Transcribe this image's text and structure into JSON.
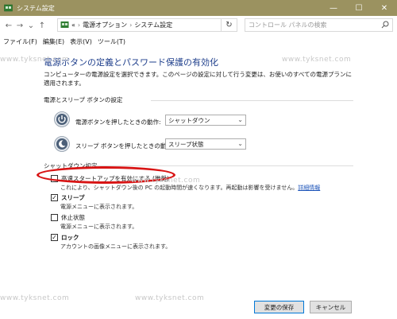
{
  "window": {
    "title": "システム設定",
    "minimize": "—",
    "maximize": "☐",
    "close": "✕"
  },
  "toolbar": {
    "back": "←",
    "forward": "→",
    "recent": "⌄",
    "up": "↑",
    "refresh": "↻"
  },
  "breadcrumb": {
    "overflow": "«",
    "items": [
      "電源オプション",
      "システム設定"
    ]
  },
  "search": {
    "placeholder": "コントロール パネルの検索"
  },
  "menu": [
    "ファイル(F)",
    "編集(E)",
    "表示(V)",
    "ツール(T)"
  ],
  "page": {
    "title": "電源ボタンの定義とパスワード保護の有効化",
    "description": "コンピューターの電源設定を選択できます。このページの設定に対して行う変更は、お使いのすべての電源プランに適用されます。"
  },
  "power_section": {
    "header": "電源とスリープ ボタンの設定",
    "power_button_label": "電源ボタンを押したときの動作:",
    "power_button_value": "シャットダウン",
    "sleep_button_label": "スリープ ボタンを押したときの動作:",
    "sleep_button_value": "スリープ状態"
  },
  "shutdown_section": {
    "header": "シャットダウン設定",
    "fast_startup": {
      "label": "高速スタートアップを有効にする (推奨)",
      "checked": false,
      "desc": "これにより、シャットダウン後の PC の起動時間が速くなります。再起動は影響を受けません。",
      "link": "詳細情報"
    },
    "sleep": {
      "label": "スリープ",
      "checked": true,
      "desc": "電源メニューに表示されます。"
    },
    "hibernate": {
      "label": "休止状態",
      "checked": false,
      "desc": "電源メニューに表示されます。"
    },
    "lock": {
      "label": "ロック",
      "checked": true,
      "desc": "アカウントの画像メニューに表示されます。"
    }
  },
  "watermark": "www.tyksnet.com",
  "footer": {
    "save": "変更の保存",
    "cancel": "キャンセル"
  },
  "colors": {
    "titlebar": "#9b9260",
    "accent_title": "#1f3f8c",
    "highlight": "#d81414",
    "link": "#1a52b8"
  }
}
